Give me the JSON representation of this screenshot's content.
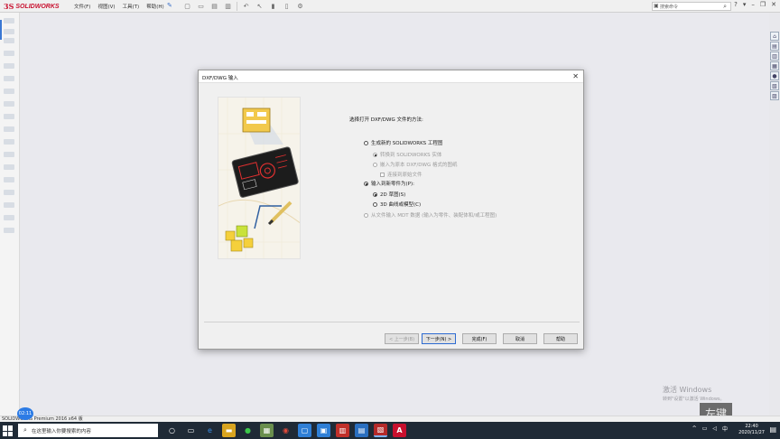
{
  "app": {
    "logo_ds": "3S",
    "logo_name": "SOLIDWORKS",
    "menus": [
      "文件(F)",
      "视图(V)",
      "工具(T)",
      "帮助(H)"
    ],
    "search_placeholder": "搜索命令"
  },
  "dialog": {
    "title": "DXF/DWG 输入",
    "prompt": "选择打开 DXF/DWG 文件的方法:",
    "options": [
      {
        "label": "生成新的 SOLIDWORKS 工程图",
        "type": "radio",
        "checked": false,
        "enabled": true
      },
      {
        "label": "转换到 SOLIDWORKS 实体",
        "type": "radio",
        "checked": true,
        "enabled": false
      },
      {
        "label": "嵌入为原本 DXF/DWG 格式的图纸",
        "type": "radio",
        "checked": false,
        "enabled": false
      },
      {
        "label": "连接到原始文件",
        "type": "checkbox",
        "checked": false,
        "enabled": false
      },
      {
        "label": "输入到新零件为(P):",
        "type": "radio",
        "checked": true,
        "enabled": true
      },
      {
        "label": "2D 草图(S)",
        "type": "radio",
        "checked": true,
        "enabled": true
      },
      {
        "label": "3D 曲线或模型(C)",
        "type": "radio",
        "checked": false,
        "enabled": true
      },
      {
        "label": "从文件输入 MDT 数据 (输入为零件、装配体和/或工程图)",
        "type": "radio",
        "checked": false,
        "enabled": false
      }
    ],
    "buttons": {
      "back": "< 上一步(B)",
      "next": "下一步(N) >",
      "finish": "完成(F)",
      "cancel": "取消",
      "help": "帮助"
    }
  },
  "statusbar": {
    "text": "SOLIDWORKS Premium 2016 x64 版",
    "rec_badge": "02:11"
  },
  "watermark": {
    "line1": "激活 Windows",
    "line2": "转到\"设置\"以激活 Windows。",
    "stamp": "左键"
  },
  "taskbar": {
    "search_placeholder": "在这里输入你要搜索的内容",
    "ime": "中",
    "time": "22:40",
    "date": "2020/11/27"
  },
  "colors": {
    "brand": "#c8102e",
    "accent": "#2e6bd1",
    "taskbar": "#1f2a36"
  }
}
